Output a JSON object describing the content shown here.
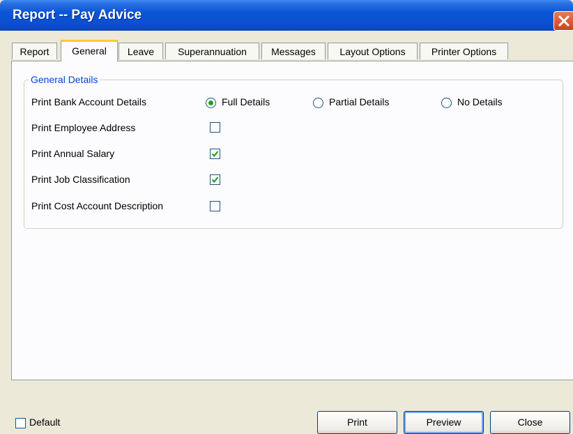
{
  "window": {
    "title": "Report -- Pay Advice"
  },
  "tabs": [
    {
      "label": "Report",
      "active": false
    },
    {
      "label": "General",
      "active": true
    },
    {
      "label": "Leave",
      "active": false
    },
    {
      "label": "Superannuation",
      "active": false
    },
    {
      "label": "Messages",
      "active": false
    },
    {
      "label": "Layout Options",
      "active": false
    },
    {
      "label": "Printer Options",
      "active": false
    }
  ],
  "general": {
    "group_title": "General Details",
    "bank_details": {
      "label": "Print Bank Account Details",
      "options": [
        "Full Details",
        "Partial Details",
        "No Details"
      ],
      "selected": "Full Details"
    },
    "rows": [
      {
        "label": "Print Employee Address",
        "checked": false
      },
      {
        "label": "Print Annual Salary",
        "checked": true
      },
      {
        "label": "Print Job Classification",
        "checked": true
      },
      {
        "label": "Print Cost Account Description",
        "checked": false
      }
    ]
  },
  "footer": {
    "default_label": "Default",
    "default_checked": false,
    "print_label": "Print",
    "preview_label": "Preview",
    "close_label": "Close"
  },
  "colors": {
    "title_bar": "#0a55d8",
    "group_title": "#0046d5",
    "check": "#21a121",
    "active_tab_accent": "#ffc83c"
  }
}
